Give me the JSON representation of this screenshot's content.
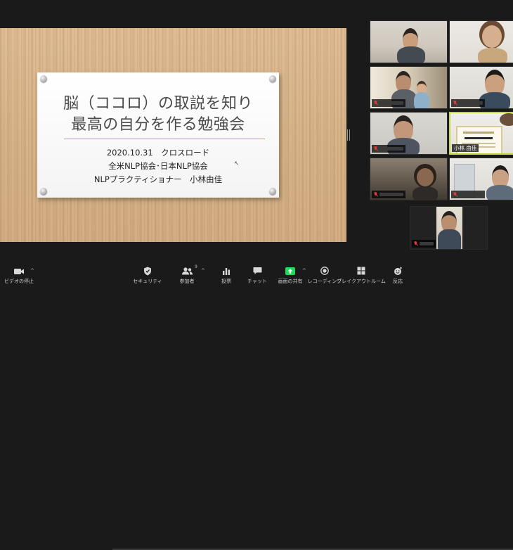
{
  "slide": {
    "title_line1": "脳（ココロ）の取説を知り",
    "title_line2": "最高の自分を作る勉強会",
    "date_line": "2020.10.31　クロスロード",
    "org_line": "全米NLP協会･日本NLP協会",
    "presenter_line": "NLPプラクティショナー　小林由佳"
  },
  "participants": [
    {
      "name": "",
      "muted": false
    },
    {
      "name": "",
      "muted": false
    },
    {
      "name": "",
      "muted": true
    },
    {
      "name": "",
      "muted": true
    },
    {
      "name": "",
      "muted": true
    },
    {
      "name": "小林 由佳",
      "muted": false,
      "active": true
    },
    {
      "name": "",
      "muted": true
    },
    {
      "name": "",
      "muted": true
    },
    {
      "name": "",
      "muted": true
    }
  ],
  "toolbar": {
    "video_stop": "ビデオの停止",
    "security": "セキュリティ",
    "participants": "参加者",
    "participants_count": "9",
    "polls": "投票",
    "chat": "チャット",
    "share_screen": "画面の共有",
    "recording": "レコーディング",
    "breakout_rooms": "ブレイクアウトルーム",
    "reactions": "反応"
  },
  "colors": {
    "share_accent": "#23d959",
    "active_speaker": "#c6d64a",
    "muted": "#e23b3b"
  },
  "icons": [
    "video-camera-icon",
    "shield-icon",
    "participants-icon",
    "polls-icon",
    "chat-bubble-icon",
    "share-screen-arrow-icon",
    "record-icon",
    "breakout-rooms-icon",
    "reactions-icon"
  ]
}
